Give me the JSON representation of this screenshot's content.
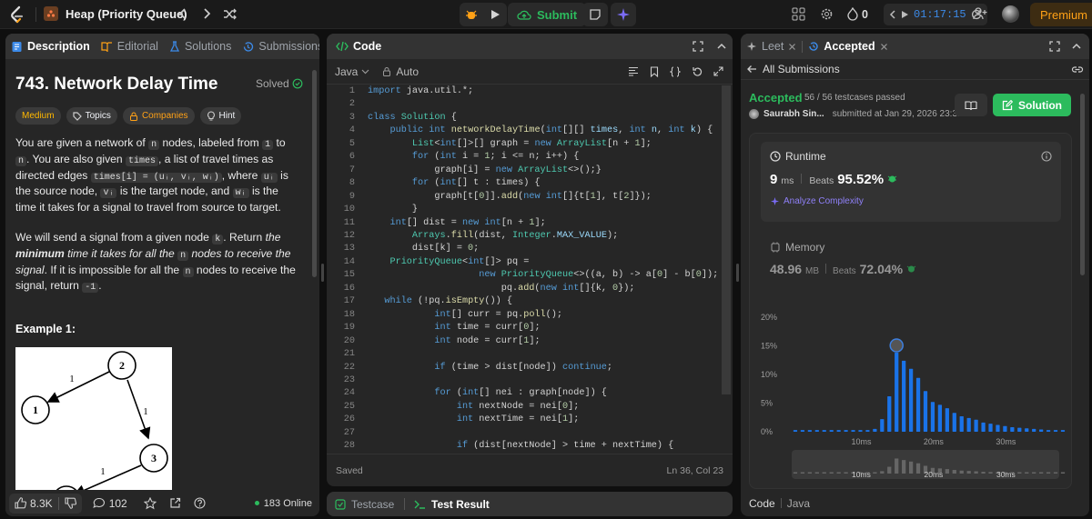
{
  "topbar": {
    "list_title": "Heap (Priority Queue)",
    "submit_label": "Submit",
    "streak_count": "0",
    "timer": "01:17:15",
    "premium_label": "Premium"
  },
  "left_tabs": {
    "description": "Description",
    "editorial": "Editorial",
    "solutions": "Solutions",
    "submissions": "Submissions"
  },
  "problem": {
    "title": "743. Network Delay Time",
    "solved_label": "Solved",
    "tags": {
      "difficulty": "Medium",
      "topics": "Topics",
      "companies": "Companies",
      "hint": "Hint"
    },
    "p1": {
      "a": "You are given a network of ",
      "n": "n",
      "b": " nodes, labeled from ",
      "one": "1",
      "c": " to ",
      "n2": "n",
      "d": ". You are also given ",
      "times": "times",
      "e": ", a list of travel times as directed edges ",
      "times_i": "times[i] = (uᵢ, vᵢ, wᵢ)",
      "f": ", where ",
      "ui": "uᵢ",
      "g": " is the source node, ",
      "vi": "vᵢ",
      "h": " is the target node, and ",
      "wi": "wᵢ",
      "i": " is the time it takes for a signal to travel from source to target."
    },
    "p2": {
      "a": "We will send a signal from a given node ",
      "k": "k",
      "b": ". Return ",
      "c": "the ",
      "d": "minimum",
      "e": " time it takes for all the ",
      "n": "n",
      "f": " nodes to receive the signal",
      "g": ". If it is impossible for all the ",
      "n2": "n",
      "h": " nodes to receive the signal, return ",
      "neg": "-1",
      "i": "."
    },
    "example_title": "Example 1:",
    "graph": {
      "nodes": [
        "2",
        "1",
        "3"
      ],
      "edge_labels": [
        "1",
        "1",
        "1"
      ]
    }
  },
  "left_footer": {
    "likes": "8.3K",
    "comments": "102",
    "online": "183 Online"
  },
  "code_panel": {
    "title": "Code",
    "language": "Java",
    "mode": "Auto",
    "status": "Saved",
    "cursor": "Ln 36, Col 23",
    "line_numbers": [
      "1",
      "2",
      "3",
      "4",
      "5",
      "6",
      "7",
      "8",
      "9",
      "10",
      "11",
      "12",
      "13",
      "14",
      "15",
      "16",
      "17",
      "18",
      "19",
      "20",
      "21",
      "22",
      "23",
      "24",
      "25",
      "26",
      "27",
      "28",
      "29"
    ]
  },
  "bottom_tabs": {
    "testcase": "Testcase",
    "result": "Test Result"
  },
  "right_tabs": {
    "leet": "Leet",
    "accepted": "Accepted"
  },
  "submission": {
    "back_label": "All Submissions",
    "status": "Accepted",
    "testcases": "56 / 56 testcases passed",
    "user": "Saurabh Sin...",
    "submitted": "submitted at Jan 29, 2026 23:31",
    "solution_btn": "Solution",
    "runtime": {
      "label": "Runtime",
      "value": "9",
      "unit": "ms",
      "beats_label": "Beats",
      "beats": "95.52%",
      "analyze": "Analyze Complexity"
    },
    "memory": {
      "label": "Memory",
      "value": "48.96",
      "unit": "MB",
      "beats_label": "Beats",
      "beats": "72.04%"
    },
    "bottom_label": "Code",
    "bottom_lang": "Java"
  },
  "chart_data": {
    "type": "bar",
    "title": "",
    "xlabel": "",
    "ylabel": "",
    "y_ticks": [
      "20%",
      "15%",
      "10%",
      "5%",
      "0%"
    ],
    "x_ticks": [
      "10ms",
      "20ms",
      "30ms"
    ],
    "ylim": [
      0,
      20
    ],
    "x_range": [
      0,
      37
    ],
    "values": [
      0.3,
      0.3,
      0.3,
      0.3,
      0.3,
      0.3,
      0.3,
      0.3,
      0.3,
      0.3,
      0.3,
      0.5,
      2.2,
      6.2,
      13.8,
      12.4,
      11.0,
      9.4,
      7.1,
      5.2,
      4.7,
      4.1,
      3.3,
      2.7,
      2.4,
      2.1,
      1.6,
      1.4,
      1.2,
      1.0,
      0.8,
      0.7,
      0.6,
      0.5,
      0.4,
      0.3,
      0.3,
      0.3
    ],
    "highlight_index": 14,
    "colors": {
      "bar": "#1a73e8",
      "selected": "#3d7fe0"
    }
  },
  "colors": {
    "accent_green": "#2cbb5d",
    "medium": "#ffb800",
    "blue_chart": "#1a73e8"
  }
}
